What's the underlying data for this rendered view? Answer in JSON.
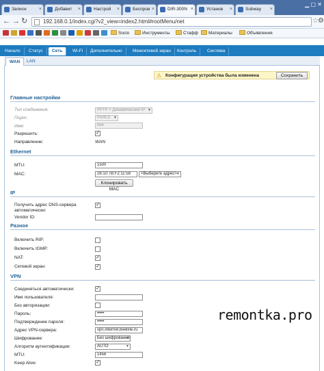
{
  "browser": {
    "tabs": [
      {
        "label": "Записи"
      },
      {
        "label": "Добавит"
      },
      {
        "label": "Настрой"
      },
      {
        "label": "Беспров"
      },
      {
        "label": "DIR-300N"
      },
      {
        "label": "Установ"
      },
      {
        "label": "Subway"
      }
    ],
    "url": "192.168.0.1/index.cgi?v2_view=index2.html#rootMenu/net",
    "bookmarks": [
      {
        "label": "Socio"
      },
      {
        "label": "Инструменты"
      },
      {
        "label": "Стафф"
      },
      {
        "label": "Материалы"
      },
      {
        "label": "Объявления"
      }
    ]
  },
  "nav": {
    "main_tabs": [
      "Начало",
      "Статус",
      "Сеть",
      "Wi-Fi",
      "Дополнительно",
      "Межсетевой экран",
      "Контроль",
      "Система"
    ],
    "sub_tabs": [
      "WAN",
      "LAN"
    ]
  },
  "notice": {
    "text": "Конфигурация устройства была изменена",
    "save_label": "Сохранить"
  },
  "main": {
    "title": "Главные настройки",
    "conn_type_label": "Тип соединения:",
    "conn_type_value": "PPTP + Динамический IP",
    "port_label": "Порт:",
    "port_value": "Port5;5",
    "name_label": "Имя:",
    "name_value": "bee",
    "enable_label": "Разрешить:",
    "direction_label": "Направление:",
    "direction_value": "WAN"
  },
  "ethernet": {
    "title": "Ethernet",
    "mtu_label": "MTU:",
    "mtu_value": "1500",
    "mac_label": "MAC:",
    "mac_value": "28:10:7B:F2:11:58",
    "mac_select": "<Выберите адрес>",
    "clone_label": "Клонировать MAC"
  },
  "ip": {
    "title": "IP",
    "dns_label_1": "Получить адрес DNS-сервера",
    "dns_label_2": "автоматически:",
    "vendor_label": "Vendor ID:",
    "vendor_value": ""
  },
  "misc": {
    "title": "Разное",
    "rip_label": "Включить RIP:",
    "igmp_label": "Включить IGMP:",
    "nat_label": "NAT:",
    "firewall_label": "Сетевой экран:"
  },
  "vpn": {
    "title": "VPN",
    "auto_label": "Соединяться автоматически:",
    "user_label": "Имя пользователя:",
    "user_value": "",
    "noauth_label": "Без авторизации:",
    "pass_label": "Пароль:",
    "pass_value": "•••••",
    "pass_confirm_label": "Подтверждение пароля:",
    "pass_confirm_value": "•••••",
    "server_label": "Адрес VPN-сервера:",
    "server_value": "vpn.internet.beeline.ru",
    "enc_label": "Шифрование:",
    "enc_value": "Без шифрования",
    "auth_label": "Алгоритм аутентификации:",
    "auth_value": "AUTO",
    "mtu_label": "MTU:",
    "mtu_value": "1456",
    "keepalive_label": "Keep Alive:"
  },
  "watermark": "remontka.pro"
}
